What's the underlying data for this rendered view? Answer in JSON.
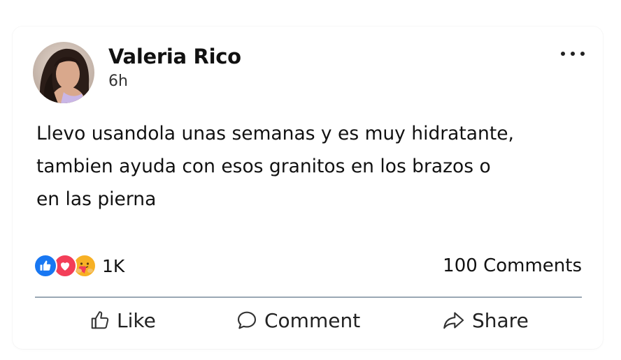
{
  "post": {
    "author": "Valeria Rico",
    "time": "6h",
    "text": "Llevo usandola unas semanas y es muy hidratante,\ntambien ayuda con esos granitos en los brazos o\nen las pierna"
  },
  "stats": {
    "reactions_count": "1K",
    "comments_count": "100  Comments",
    "reaction_icons": [
      "like-icon",
      "love-icon",
      "care-icon"
    ]
  },
  "actions": {
    "like_label": "Like",
    "comment_label": "Comment",
    "share_label": "Share"
  },
  "colors": {
    "like_blue": "#1877f2",
    "love_red": "#f33e58",
    "care_yellow": "#f7b125",
    "divider": "#9aa7b4"
  }
}
